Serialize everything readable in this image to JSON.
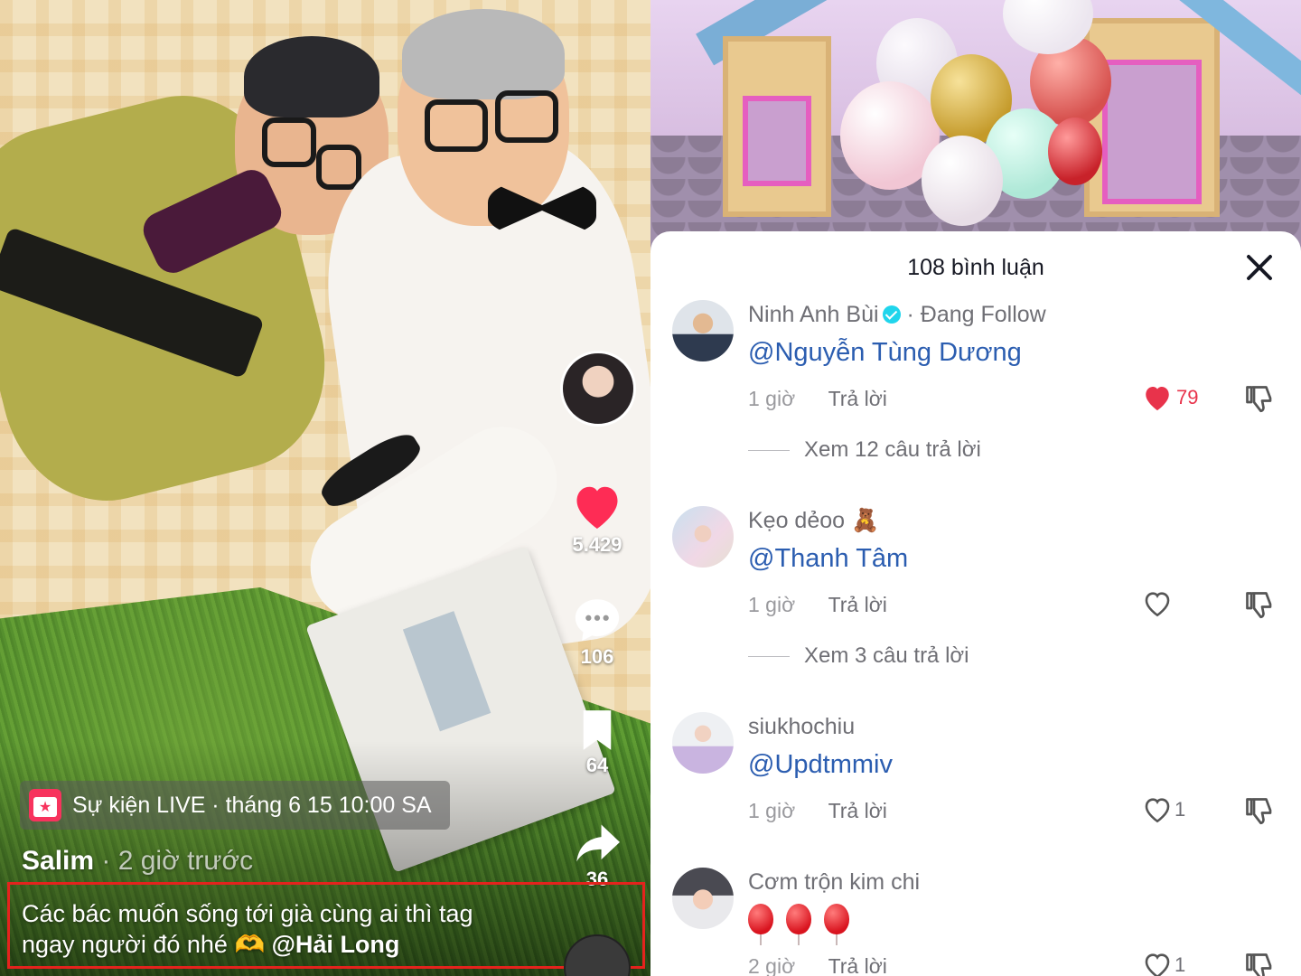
{
  "video": {
    "event_badge_text": "Sự kiện LIVE · tháng 6 15 10:00 SA",
    "author": "Salim",
    "posted_time": "· 2 giờ trước",
    "caption_text": "Các bác muốn sống tới già cùng ai thì tag ngay người đó nhé 🫶",
    "caption_mention": "@Hải Long",
    "rail": {
      "likes": "5.429",
      "comments": "106",
      "bookmarks": "64",
      "shares": "36"
    },
    "colors": {
      "like_heart": "#fe2c55",
      "highlight_box": "#e4231d"
    }
  },
  "comments_panel": {
    "title": "108 bình luận",
    "comments": [
      {
        "name": "Ninh Anh Bùi",
        "verified": true,
        "follow_status": "· Đang Follow",
        "text": "@Nguyễn Tùng Dương",
        "time": "1 giờ",
        "reply_label": "Trả lời",
        "likes": "79",
        "liked": true,
        "view_replies": "Xem 12 câu trả lời"
      },
      {
        "name": "Kẹo dẻoo 🧸",
        "text": "@Thanh Tâm",
        "time": "1 giờ",
        "reply_label": "Trả lời",
        "likes": "",
        "liked": false,
        "view_replies": "Xem 3 câu trả lời"
      },
      {
        "name": "siukhochiu",
        "text": "@Updtmmiv",
        "time": "1 giờ",
        "reply_label": "Trả lời",
        "likes": "1",
        "liked": false
      },
      {
        "name": "Cơm trộn kim chi",
        "text_emoji": "balloon-emoji x3",
        "time": "2 giờ",
        "reply_label": "Trả lời",
        "likes": "1",
        "liked": false
      }
    ],
    "colors": {
      "mention": "#2b5db0",
      "liked_heart": "#e8334b",
      "verified": "#20d5ec"
    }
  }
}
